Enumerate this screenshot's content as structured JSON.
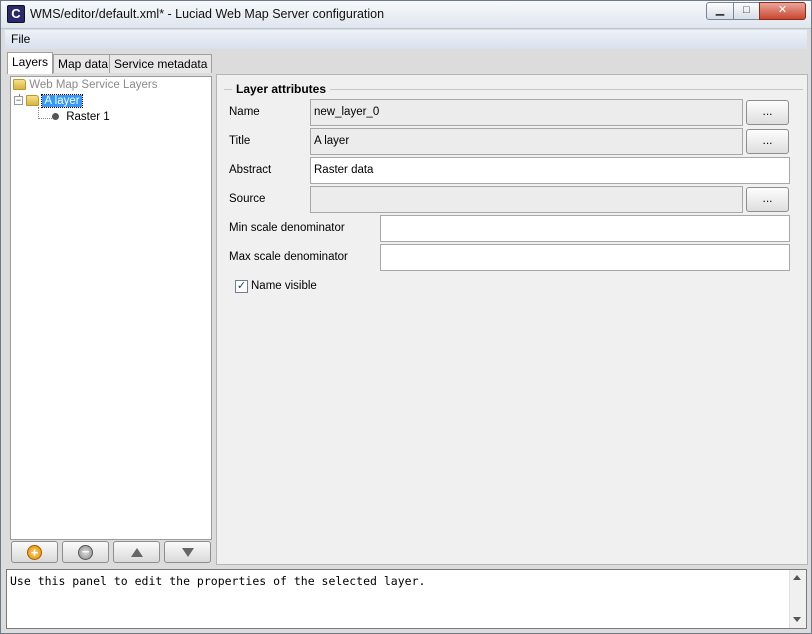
{
  "window": {
    "title": "WMS/editor/default.xml* - Luciad Web Map Server configuration",
    "app_icon_glyph": "C",
    "minimize_glyph": "▁",
    "maximize_glyph": "□",
    "close_glyph": "✕"
  },
  "menu": {
    "file": "File"
  },
  "tabs": [
    {
      "label": "Layers",
      "active": true
    },
    {
      "label": "Map data",
      "active": false
    },
    {
      "label": "Service metadata",
      "active": false
    }
  ],
  "tree": {
    "root": "Web Map Service Layers",
    "layer": "A layer",
    "layer_expander": "−",
    "child": "Raster 1"
  },
  "tree_buttons": {
    "add_glyph": "+",
    "remove_glyph": "−"
  },
  "attributes": {
    "group_title": "Layer attributes",
    "name_label": "Name",
    "name_value": "new_layer_0",
    "title_label": "Title",
    "title_value": "A layer",
    "abstract_label": "Abstract",
    "abstract_value": "Raster data",
    "source_label": "Source",
    "source_value": "",
    "min_scale_label": "Min scale denominator",
    "min_scale_value": "",
    "max_scale_label": "Max scale denominator",
    "max_scale_value": "",
    "browse_label": "...",
    "name_visible_label": "Name visible",
    "name_visible_checked": true,
    "check_glyph": "✓"
  },
  "info": {
    "text": "Use this panel to edit the properties of the selected layer."
  }
}
